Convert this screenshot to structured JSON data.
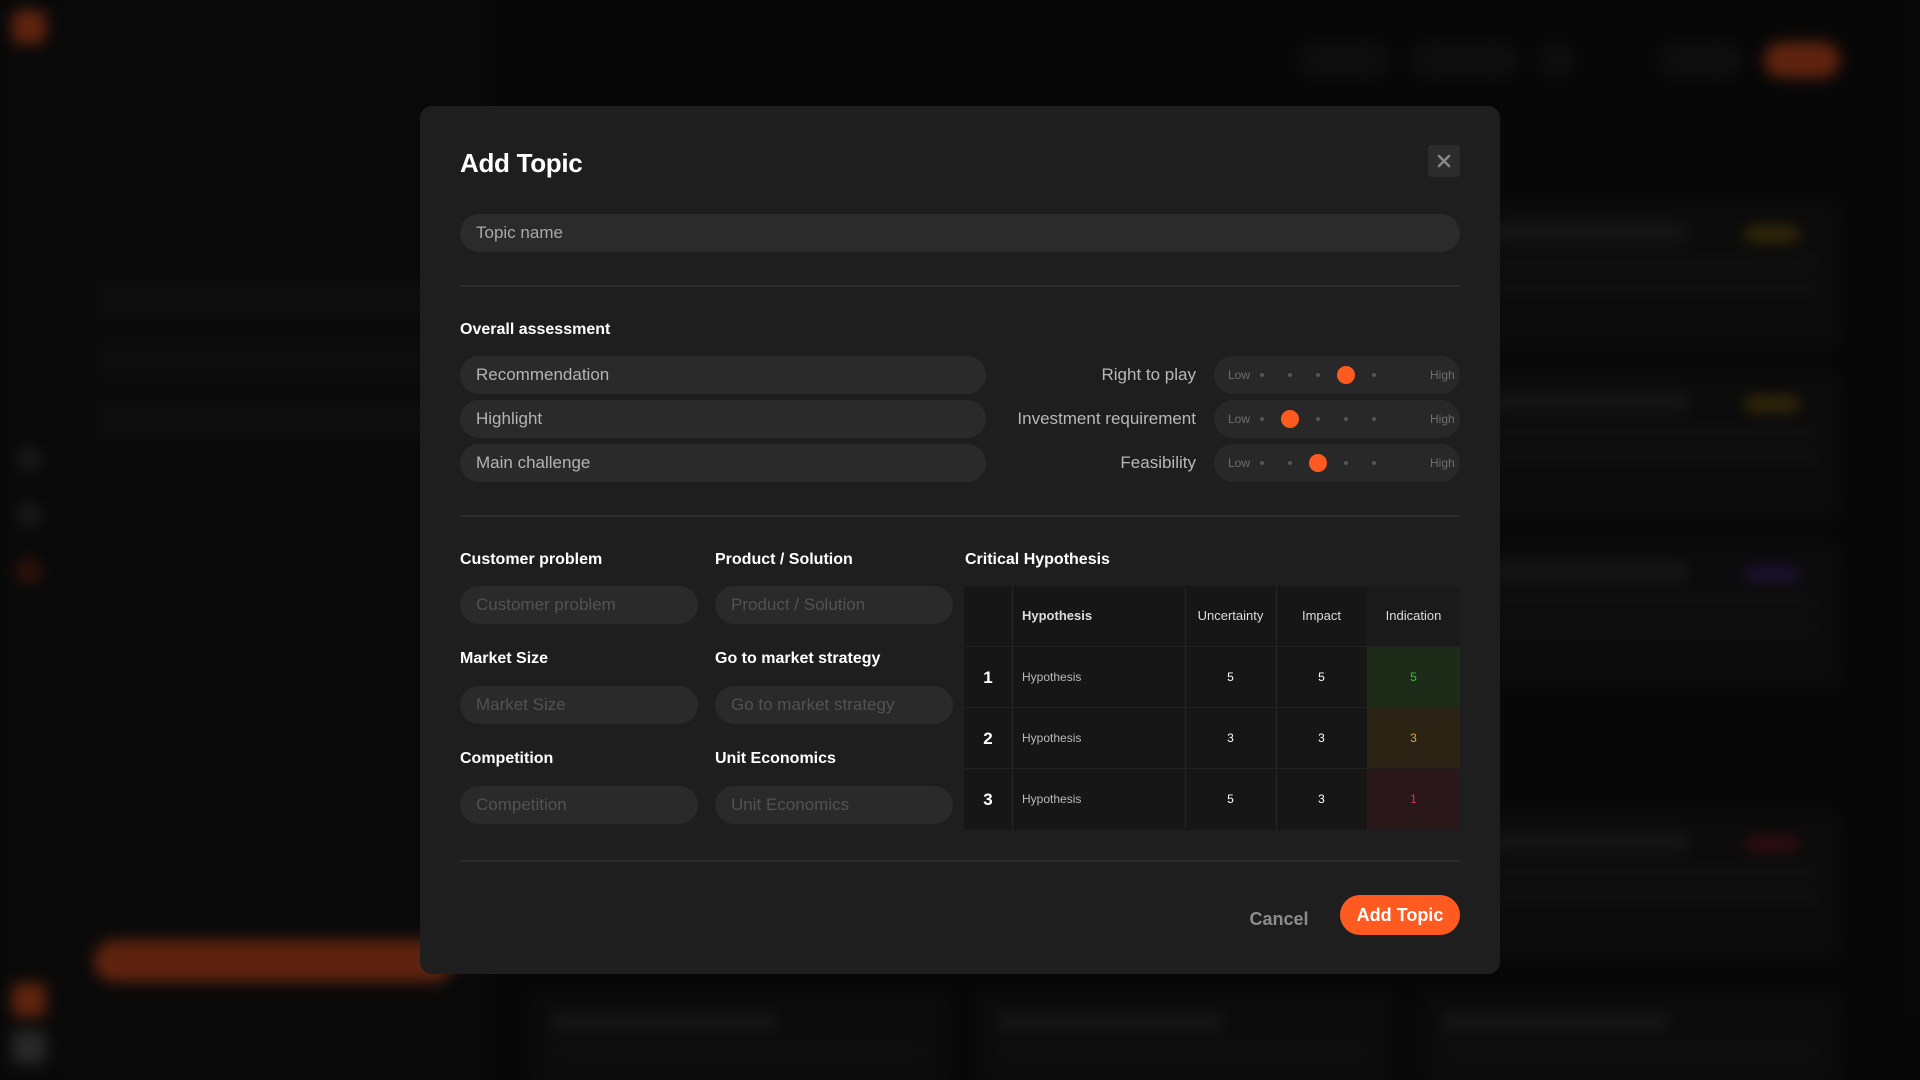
{
  "modal": {
    "title": "Add Topic",
    "topic_name_placeholder": "Topic name",
    "overall_assessment_label": "Overall assessment",
    "assessment_fields": [
      "Recommendation",
      "Highlight",
      "Main challenge"
    ],
    "sliders": [
      {
        "label": "Right to play",
        "low": "Low",
        "high": "High",
        "level": 4,
        "of": 5
      },
      {
        "label": "Investment requirement",
        "low": "Low",
        "high": "High",
        "level": 2,
        "of": 5
      },
      {
        "label": "Feasibility",
        "low": "Low",
        "high": "High",
        "level": 3,
        "of": 5
      }
    ],
    "sections": {
      "customer_problem": {
        "label": "Customer problem",
        "placeholder": "Customer problem"
      },
      "product_solution": {
        "label": "Product / Solution",
        "placeholder": "Product / Solution"
      },
      "market_size": {
        "label": "Market Size",
        "placeholder": "Market Size"
      },
      "go_to_market": {
        "label": "Go to market strategy",
        "placeholder": "Go to market strategy"
      },
      "competition": {
        "label": "Competition",
        "placeholder": "Competition"
      },
      "unit_economics": {
        "label": "Unit Economics",
        "placeholder": "Unit Economics"
      }
    },
    "critical_hypothesis": {
      "label": "Critical Hypothesis",
      "columns": [
        "Hypothesis",
        "Uncertainty",
        "Impact",
        "Indication"
      ],
      "rows": [
        {
          "num": "1",
          "hypothesis": "Hypothesis",
          "uncertainty": "5",
          "impact": "5",
          "indication": "5",
          "indication_color": "#3fbf3f",
          "indication_bg": "#1c2c18"
        },
        {
          "num": "2",
          "hypothesis": "Hypothesis",
          "uncertainty": "3",
          "impact": "3",
          "indication": "3",
          "indication_color": "#e8a030",
          "indication_bg": "#2b2415"
        },
        {
          "num": "3",
          "hypothesis": "Hypothesis",
          "uncertainty": "5",
          "impact": "3",
          "indication": "1",
          "indication_color": "#e0304a",
          "indication_bg": "#2a171a"
        }
      ]
    },
    "cancel_label": "Cancel",
    "submit_label": "Add Topic"
  },
  "colors": {
    "accent": "#ff5a1f",
    "modal_bg": "#1e1e1e"
  },
  "icons": {
    "close": "close-icon"
  }
}
